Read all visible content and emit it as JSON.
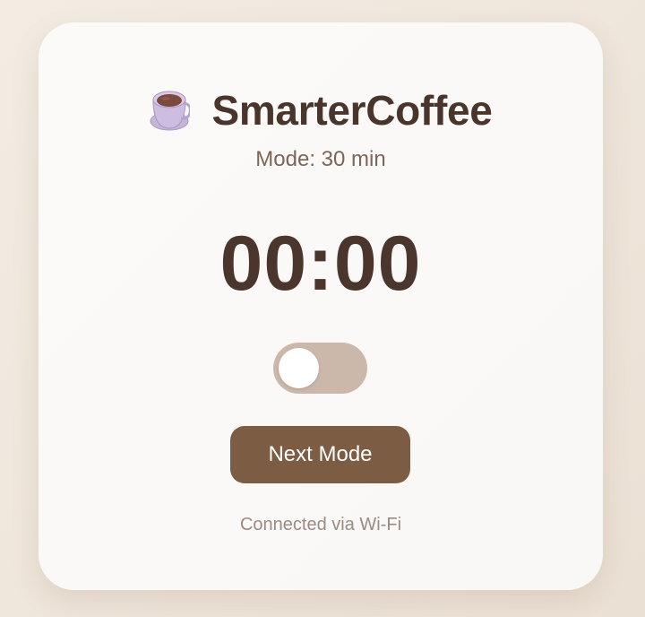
{
  "app": {
    "title": "SmarterCoffee",
    "icon": "coffee-cup-icon"
  },
  "mode": {
    "label": "Mode: 30 min"
  },
  "timer": {
    "display": "00:00"
  },
  "toggle": {
    "state": "off"
  },
  "controls": {
    "next_mode_label": "Next Mode"
  },
  "status": {
    "connection": "Connected via Wi-Fi"
  },
  "colors": {
    "background": "#efe5da",
    "card": "#fbfaf8",
    "title_text": "#4a352c",
    "toggle_track": "#cbb8aa",
    "button": "#7d5c44",
    "muted_text": "#9a8a80"
  }
}
